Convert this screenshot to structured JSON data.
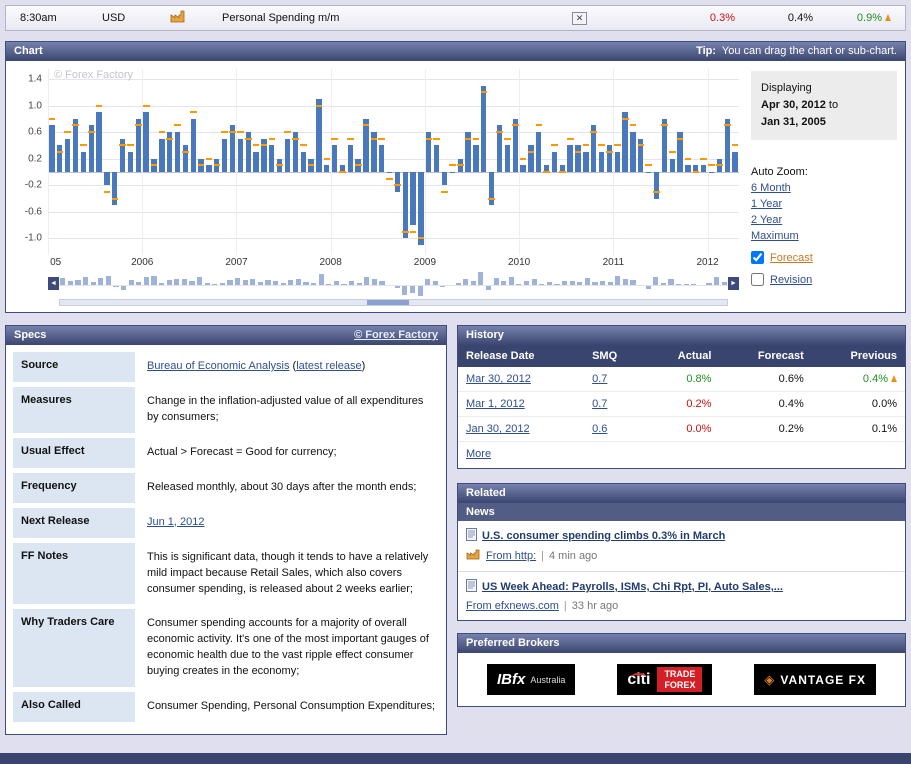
{
  "icons": {
    "left_arrow": "◄",
    "right_arrow": "►",
    "seen": "✕",
    "pipe": "|"
  },
  "event_bar": {
    "time": "8:30am",
    "currency": "USD",
    "title": "Personal Spending m/m",
    "actual": "0.3%",
    "actual_color": "#cc1111",
    "forecast": "0.4%",
    "forecast_color": "#111111",
    "previous": "0.9%",
    "previous_color": "#1f8f1f"
  },
  "chart_panel": {
    "title": "Chart",
    "tip_bold": "Tip:",
    "tip_rest": "You can drag the chart or sub-chart.",
    "watermark": "© Forex Factory",
    "displaying_label": "Displaying",
    "displaying_from": "Apr 30, 2012",
    "to_word": "to",
    "displaying_to": "Jan 31, 2005",
    "auto_zoom_label": "Auto Zoom:",
    "zoom_links": [
      "6 Month",
      "1 Year",
      "2 Year",
      "Maximum"
    ],
    "forecast_label": "Forecast",
    "revision_label": "Revision",
    "y_ticks": [
      "1.4",
      "1.0",
      "0.6",
      "0.2",
      "-0.2",
      "-0.6",
      "-1.0"
    ],
    "x_ticks": [
      "05",
      "2006",
      "2007",
      "2008",
      "2009",
      "2010",
      "2011",
      "2012"
    ],
    "bar_color": "#4a78bd",
    "forecast_tick_color": "#ff9900",
    "mini_bar_color": "#9fb3d8"
  },
  "chart_data": {
    "type": "bar",
    "title": "Personal Spending m/m",
    "x_first": "Jan 2005",
    "x_last": "Apr 2012",
    "interval": "monthly",
    "ylim": [
      -1.25,
      1.55
    ],
    "values": [
      0.7,
      0.4,
      0.5,
      0.8,
      0.3,
      0.7,
      0.9,
      -0.2,
      -0.5,
      0.5,
      0.3,
      0.8,
      0.9,
      0.2,
      0.5,
      0.6,
      0.6,
      0.4,
      0.8,
      0.2,
      0.1,
      0.2,
      0.5,
      0.7,
      0.5,
      0.6,
      0.3,
      0.5,
      0.4,
      0.2,
      0.5,
      0.6,
      0.3,
      0.2,
      1.1,
      0.1,
      0.4,
      0.1,
      0.4,
      0.2,
      0.8,
      0.6,
      0.4,
      0.0,
      -0.3,
      -1.0,
      -0.8,
      -1.1,
      0.6,
      0.4,
      -0.2,
      0.0,
      0.2,
      0.6,
      0.4,
      1.3,
      -0.5,
      0.7,
      0.4,
      0.8,
      0.1,
      0.4,
      0.6,
      0.1,
      0.3,
      0.1,
      0.4,
      0.4,
      0.3,
      0.7,
      0.3,
      0.4,
      0.3,
      0.9,
      0.6,
      0.5,
      0.0,
      -0.4,
      0.8,
      0.2,
      0.6,
      0.1,
      0.1,
      0.1,
      0.0,
      0.2,
      0.8,
      0.3
    ],
    "forecast": [
      0.8,
      0.3,
      0.6,
      0.7,
      0.4,
      0.6,
      1.0,
      -0.3,
      -0.4,
      0.4,
      0.4,
      0.7,
      1.0,
      0.1,
      0.6,
      0.5,
      0.7,
      0.3,
      0.9,
      0.1,
      0.2,
      0.1,
      0.6,
      0.6,
      0.6,
      0.5,
      0.4,
      0.4,
      0.5,
      0.1,
      0.6,
      0.5,
      0.4,
      0.1,
      1.0,
      0.2,
      0.5,
      0.0,
      0.5,
      0.1,
      0.7,
      0.5,
      0.5,
      -0.1,
      -0.2,
      -0.9,
      -0.9,
      -1.0,
      0.5,
      0.5,
      -0.3,
      0.1,
      0.1,
      0.5,
      0.5,
      1.2,
      -0.4,
      0.6,
      0.5,
      0.7,
      0.2,
      0.3,
      0.7,
      0.0,
      0.4,
      0.0,
      0.5,
      0.3,
      0.4,
      0.6,
      0.4,
      0.3,
      0.4,
      0.8,
      0.7,
      0.4,
      0.1,
      -0.3,
      0.7,
      0.3,
      0.5,
      0.2,
      0.0,
      0.2,
      0.1,
      0.1,
      0.7,
      0.4
    ]
  },
  "specs": {
    "title": "Specs",
    "copyright_link": "© Forex Factory",
    "rows": [
      {
        "label": "Source",
        "type": "source",
        "link1": "Bureau of Economic Analysis",
        "pre": " (",
        "link2": "latest release",
        "post": ")"
      },
      {
        "label": "Measures",
        "type": "text",
        "value": "Change in the inflation-adjusted value of all expenditures by consumers;"
      },
      {
        "label": "Usual Effect",
        "type": "text",
        "value": "Actual > Forecast = Good for currency;"
      },
      {
        "label": "Frequency",
        "type": "text",
        "value": "Released monthly, about 30 days after the month ends;"
      },
      {
        "label": "Next Release",
        "type": "link",
        "value": "Jun 1, 2012"
      },
      {
        "label": "FF Notes",
        "type": "text",
        "value": "This is significant data, though it tends to have a relatively mild impact because Retail Sales, which also covers consumer spending, is released about 2 weeks earlier;"
      },
      {
        "label": "Why Traders Care",
        "type": "text",
        "value": "Consumer spending accounts for a majority of overall economic activity. It's one of the most important gauges of economic health due to the vast ripple effect consumer buying creates in the economy;"
      },
      {
        "label": "Also Called",
        "type": "text",
        "value": "Consumer Spending, Personal Consumption Expenditures;"
      }
    ]
  },
  "history": {
    "title": "History",
    "columns": [
      "Release Date",
      "SMQ",
      "Actual",
      "Forecast",
      "Previous"
    ],
    "rows": [
      {
        "date": "Mar 30, 2012",
        "smq": "0.7",
        "actual": "0.8%",
        "actual_color": "#1f8f1f",
        "forecast": "0.6%",
        "previous": "0.4%",
        "previous_color": "#1f8f1f",
        "revision": true
      },
      {
        "date": "Mar 1, 2012",
        "smq": "0.7",
        "actual": "0.2%",
        "actual_color": "#cc1111",
        "forecast": "0.4%",
        "previous": "0.0%",
        "previous_color": "#111111",
        "revision": false
      },
      {
        "date": "Jan 30, 2012",
        "smq": "0.6",
        "actual": "0.0%",
        "actual_color": "#cc1111",
        "forecast": "0.2%",
        "previous": "0.1%",
        "previous_color": "#111111",
        "revision": false
      }
    ],
    "more_label": "More"
  },
  "related": {
    "title": "Related",
    "news_label": "News",
    "items": [
      {
        "title": "U.S. consumer spending climbs 0.3% in March",
        "from": "From http:",
        "meta": "4 min ago",
        "factory_icon": true
      },
      {
        "title": "US Week Ahead: Payrolls, ISMs, Chi Rpt, PI, Auto Sales,...",
        "from": "From efxnews.com",
        "meta": "33 hr ago",
        "factory_icon": false
      }
    ]
  },
  "brokers": {
    "title": "Preferred Brokers",
    "ibfx_name": "IBfx",
    "ibfx_sub": "Australia",
    "citi_name": "citi",
    "citi_line1": "TRADE",
    "citi_line2": "FOREX",
    "vantage_name": "VANTAGE FX"
  }
}
